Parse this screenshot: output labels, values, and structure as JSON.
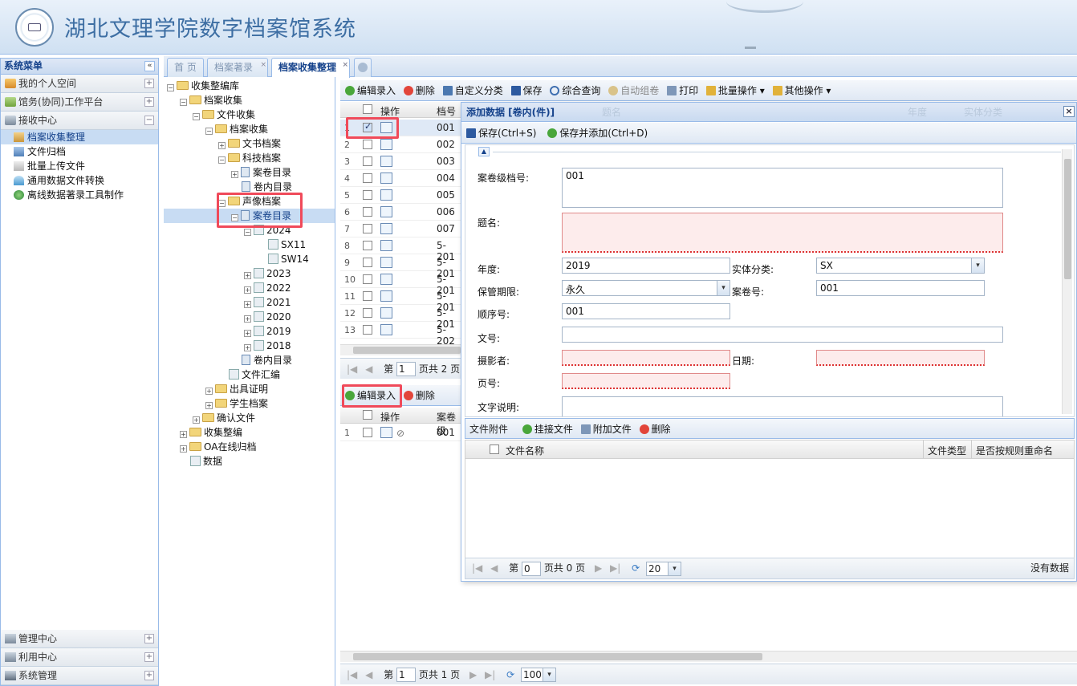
{
  "app": {
    "title": "湖北文理学院数字档案馆系统"
  },
  "sidebar": {
    "title": "系统菜单",
    "collapse": "«",
    "sections": [
      {
        "label": "我的个人空间"
      },
      {
        "label": "馆务(协同)工作平台"
      },
      {
        "label": "接收中心"
      }
    ],
    "sub_items": [
      {
        "label": "档案收集整理"
      },
      {
        "label": "文件归档"
      },
      {
        "label": "批量上传文件"
      },
      {
        "label": "通用数据文件转换"
      },
      {
        "label": "离线数据著录工具制作"
      }
    ],
    "bottom_sections": [
      {
        "label": "管理中心"
      },
      {
        "label": "利用中心"
      },
      {
        "label": "系统管理"
      }
    ]
  },
  "tabs": [
    {
      "label": "首 页"
    },
    {
      "label": "档案著录"
    },
    {
      "label": "档案收集整理"
    }
  ],
  "tree": [
    {
      "label": "收集整编库"
    },
    {
      "label": "档案收集"
    },
    {
      "label": "文件收集"
    },
    {
      "label": "档案收集"
    },
    {
      "label": "文书档案"
    },
    {
      "label": "科技档案"
    },
    {
      "label": "案卷目录"
    },
    {
      "label": "卷内目录"
    },
    {
      "label": "声像档案"
    },
    {
      "label": "案卷目录"
    },
    {
      "label": "2024"
    },
    {
      "label": "SX11"
    },
    {
      "label": "SW14"
    },
    {
      "label": "2023"
    },
    {
      "label": "2022"
    },
    {
      "label": "2021"
    },
    {
      "label": "2020"
    },
    {
      "label": "2019"
    },
    {
      "label": "2018"
    },
    {
      "label": "卷内目录"
    },
    {
      "label": "文件汇编"
    },
    {
      "label": "出具证明"
    },
    {
      "label": "学生档案"
    },
    {
      "label": "确认文件"
    },
    {
      "label": "收集整编"
    },
    {
      "label": "OA在线归档"
    },
    {
      "label": "数据"
    }
  ],
  "upper_toolbar": {
    "edit": "编辑录入",
    "delete": "删除",
    "custom": "自定义分类",
    "save": "保存",
    "query": "综合查询",
    "auto": "自动组卷",
    "print": "打印",
    "batch": "批量操作 ▾",
    "other": "其他操作 ▾"
  },
  "upper_grid": {
    "col_op": "操作",
    "col_no": "档号",
    "rows": [
      {
        "n": "1",
        "v": "001"
      },
      {
        "n": "2",
        "v": "002"
      },
      {
        "n": "3",
        "v": "003"
      },
      {
        "n": "4",
        "v": "004"
      },
      {
        "n": "5",
        "v": "005"
      },
      {
        "n": "6",
        "v": "006"
      },
      {
        "n": "7",
        "v": "007"
      },
      {
        "n": "8",
        "v": "5-201"
      },
      {
        "n": "9",
        "v": "5-201"
      },
      {
        "n": "10",
        "v": "5-201"
      },
      {
        "n": "11",
        "v": "5-201"
      },
      {
        "n": "12",
        "v": "5-201"
      },
      {
        "n": "13",
        "v": "5-202"
      }
    ],
    "pager": {
      "page_label": "第",
      "page": "1",
      "total": "页共 2 页"
    }
  },
  "lower_toolbar": {
    "edit": "编辑录入",
    "delete": "删除"
  },
  "lower_grid": {
    "col_op": "操作",
    "col_no": "案卷级",
    "rows": [
      {
        "n": "1",
        "v": "001"
      }
    ],
    "pager": {
      "page_label": "第",
      "page": "1",
      "total": "页共 1 页",
      "size": "100"
    }
  },
  "dialog": {
    "title": "添加数据 [卷内(件)]",
    "ghost_headers": [
      "题名",
      "年度",
      "实体分类"
    ],
    "save": "保存(Ctrl+S)",
    "save_add": "保存并添加(Ctrl+D)",
    "fields": {
      "case_no_label": "案卷级档号:",
      "case_no_value": "001",
      "title_label": "题名:",
      "year_label": "年度:",
      "year_value": "2019",
      "class_label": "实体分类:",
      "class_value": "SX",
      "keep_label": "保管期限:",
      "keep_value": "永久",
      "vol_label": "案卷号:",
      "vol_value": "001",
      "seq_label": "顺序号:",
      "seq_value": "001",
      "docno_label": "文号:",
      "photo_label": "摄影者:",
      "date_label": "日期:",
      "page_label": "页号:",
      "desc_label": "文字说明:"
    },
    "attachments": {
      "title": "文件附件",
      "hook": "挂接文件",
      "add": "附加文件",
      "delete": "删除",
      "col_name": "文件名称",
      "col_type": "文件类型",
      "col_rename": "是否按规则重命名",
      "pager": {
        "page_label": "第",
        "page": "0",
        "total": "页共 0 页",
        "size": "20",
        "empty": "没有数据"
      }
    }
  }
}
